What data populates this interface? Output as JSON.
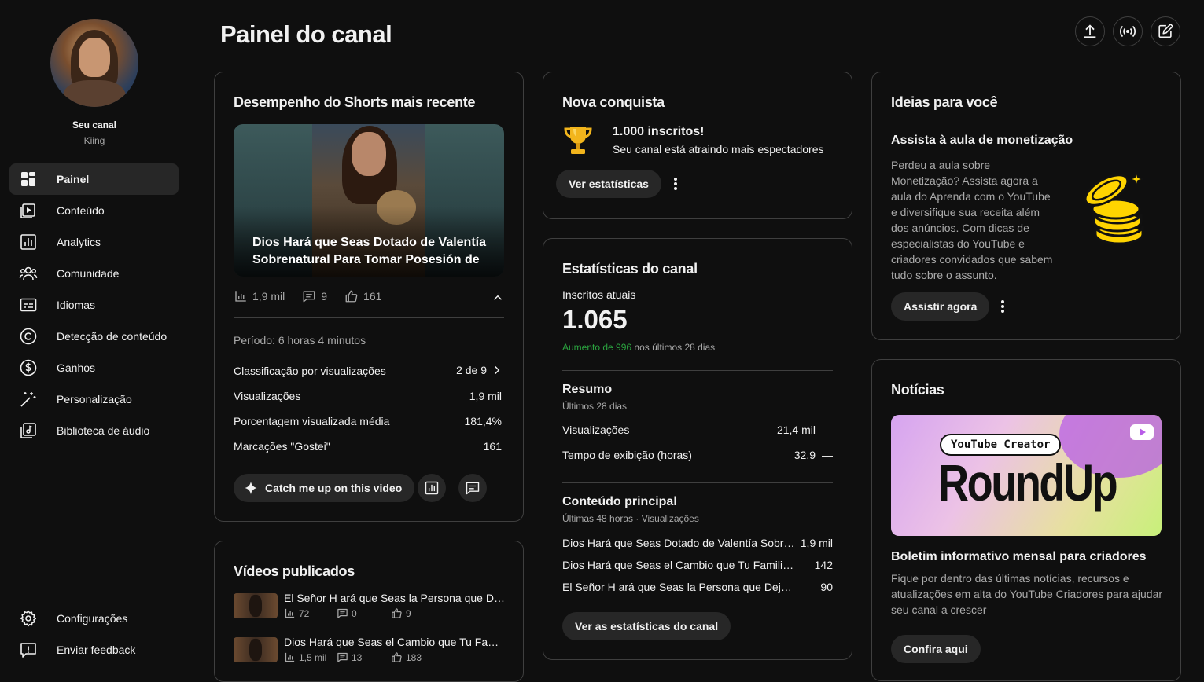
{
  "sidebar": {
    "channel_label": "Seu canal",
    "channel_name": "Kiing",
    "items": [
      {
        "label": "Painel",
        "icon": "dashboard-icon"
      },
      {
        "label": "Conteúdo",
        "icon": "content-icon"
      },
      {
        "label": "Analytics",
        "icon": "analytics-icon"
      },
      {
        "label": "Comunidade",
        "icon": "community-icon"
      },
      {
        "label": "Idiomas",
        "icon": "subtitles-icon"
      },
      {
        "label": "Detecção de conteúdo",
        "icon": "copyright-icon"
      },
      {
        "label": "Ganhos",
        "icon": "earn-icon"
      },
      {
        "label": "Personalização",
        "icon": "magic-wand-icon"
      },
      {
        "label": "Biblioteca de áudio",
        "icon": "audio-library-icon"
      }
    ],
    "bottom_items": [
      {
        "label": "Configurações",
        "icon": "gear-icon"
      },
      {
        "label": "Enviar feedback",
        "icon": "feedback-icon"
      }
    ]
  },
  "header": {
    "title": "Painel do canal"
  },
  "shorts_card": {
    "title": "Desempenho do Shorts mais recente",
    "video_title": "Dios Hará que Seas Dotado de Valentía Sobrenatural Para Tomar Posesión de T...",
    "views": "1,9 mil",
    "comments": "9",
    "likes": "161",
    "period": "Período: 6 horas 4 minutos",
    "rows": [
      {
        "label": "Classificação por visualizações",
        "value": "2 de 9"
      },
      {
        "label": "Visualizações",
        "value": "1,9 mil"
      },
      {
        "label": "Porcentagem visualizada média",
        "value": "181,4%"
      },
      {
        "label": "Marcações \"Gostei\"",
        "value": "161"
      }
    ],
    "catch_up_label": "Catch me up on this video"
  },
  "published_card": {
    "title": "Vídeos publicados",
    "videos": [
      {
        "title": "El Señor H ará que Seas la Persona que Dejaste de Ser",
        "views": "72",
        "comments": "0",
        "likes": "9"
      },
      {
        "title": "Dios Hará que Seas el Cambio que Tu Familia Necesita",
        "views": "1,5 mil",
        "comments": "13",
        "likes": "183"
      }
    ]
  },
  "achievement_card": {
    "title": "Nova conquista",
    "headline": "1.000 inscritos!",
    "subtext": "Seu canal está atraindo mais espectadores",
    "button": "Ver estatísticas"
  },
  "stats_card": {
    "title": "Estatísticas do canal",
    "subs_label": "Inscritos atuais",
    "subs_value": "1.065",
    "growth_highlight": "Aumento de 996",
    "growth_rest": "nos últimos 28 dias",
    "summary_title": "Resumo",
    "summary_period": "Últimos 28 dias",
    "summary_rows": [
      {
        "label": "Visualizações",
        "value": "21,4 mil",
        "trend": "—"
      },
      {
        "label": "Tempo de exibição (horas)",
        "value": "32,9",
        "trend": "—"
      }
    ],
    "top_title": "Conteúdo principal",
    "top_period": "Últimas 48 horas · Visualizações",
    "top_rows": [
      {
        "label": "Dios Hará que Seas Dotado de Valentía Sobrenatural Para Tomar Posesión",
        "value": "1,9 mil"
      },
      {
        "label": "Dios Hará que Seas el Cambio que Tu Familia Necesita",
        "value": "142"
      },
      {
        "label": "El Señor H ará que Seas la Persona que Dejaste de Ser",
        "value": "90"
      }
    ],
    "button": "Ver as estatísticas do canal"
  },
  "ideas_card": {
    "title": "Ideias para você",
    "subtitle": "Assista à aula de monetização",
    "body": "Perdeu a aula sobre Monetização? Assista agora a aula do Aprenda com o YouTube e diversifique sua receita além dos anúncios. Com dicas de especialistas do YouTube e criadores convidados que sabem tudo sobre o assunto.",
    "button": "Assistir agora"
  },
  "news_card": {
    "title": "Notícias",
    "badge": "YouTube Creator",
    "big_text": "RoundUp",
    "headline": "Boletim informativo mensal para criadores",
    "body": "Fique por dentro das últimas notícias, recursos e atualizações em alta do YouTube Criadores para ajudar seu canal a crescer",
    "button": "Confira aqui"
  },
  "colors": {
    "background": "#0f0f0f",
    "card_border": "#3f3f3f",
    "pill_bg": "#272727",
    "growth_green": "#2ba640",
    "coin_yellow": "#ffd400"
  }
}
